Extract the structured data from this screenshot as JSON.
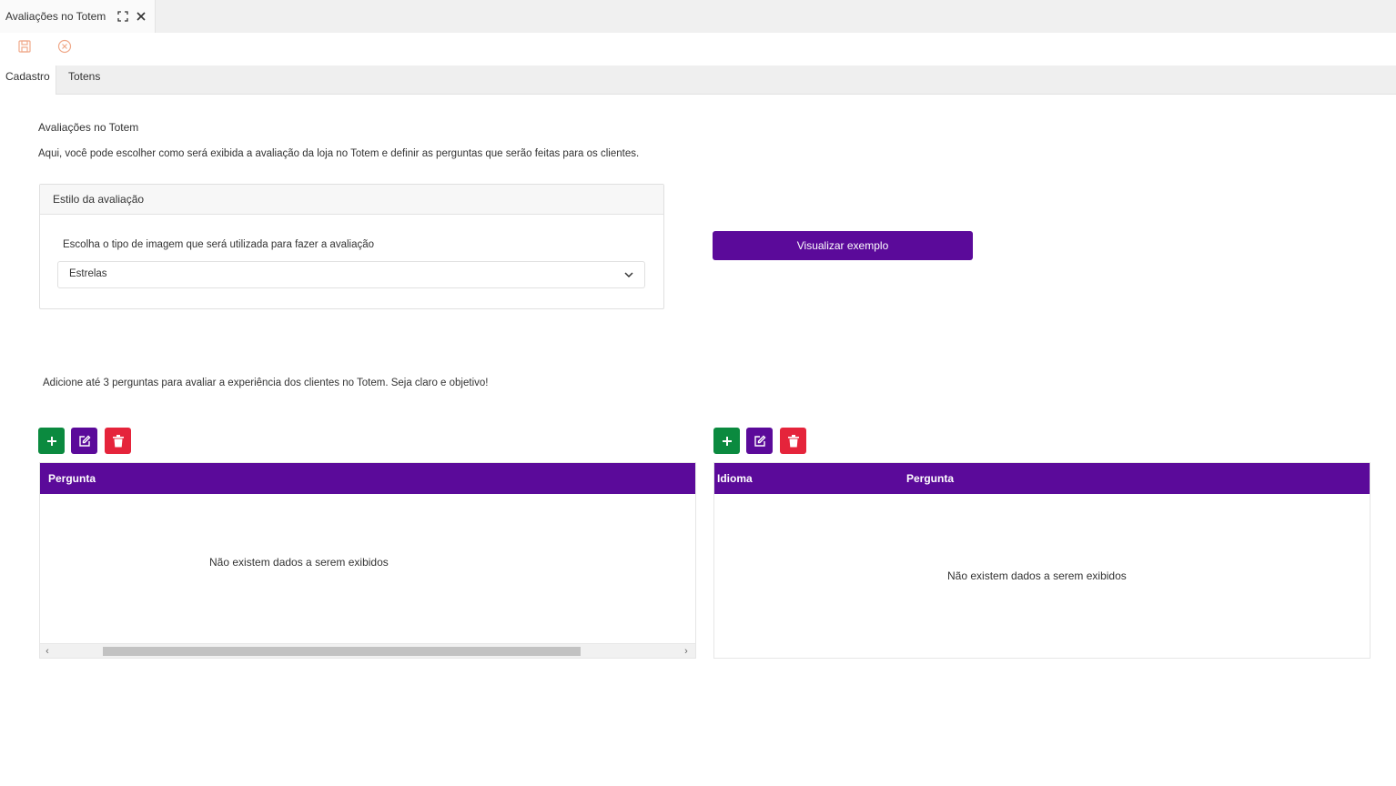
{
  "window": {
    "tab_title": "Avaliações no Totem"
  },
  "tabs": [
    "Cadastro",
    "Totens"
  ],
  "content": {
    "title": "Avaliações no Totem",
    "description": "Aqui, você pode escolher como será exibida a avaliação da loja no Totem e definir as perguntas que serão feitas para os clientes."
  },
  "style_panel": {
    "header": "Estilo da avaliação",
    "label": "Escolha o tipo de imagem que será utilizada para fazer a avaliação",
    "selected": "Estrelas"
  },
  "preview_button": "Visualizar exemplo",
  "questions_hint": "Adicione até 3 perguntas para avaliar a experiência dos clientes no Totem. Seja claro e objetivo!",
  "grid_left": {
    "columns": [
      "Pergunta"
    ],
    "empty_text": "Não existem dados a serem exibidos"
  },
  "grid_right": {
    "columns": [
      "Idioma",
      "Pergunta"
    ],
    "empty_text": "Não existem dados a serem exibidos"
  },
  "icons": {
    "maximize": "maximize-icon",
    "close": "close-icon",
    "save": "save-icon",
    "cancel": "cancel-icon",
    "add": "plus-icon",
    "edit": "edit-icon",
    "delete": "trash-icon",
    "dropdown": "chevron-down-icon"
  },
  "colors": {
    "primary": "#5b0a9a",
    "add": "#0b8a3f",
    "delete": "#e5243b",
    "toolbar_icon": "#f0a98a"
  }
}
